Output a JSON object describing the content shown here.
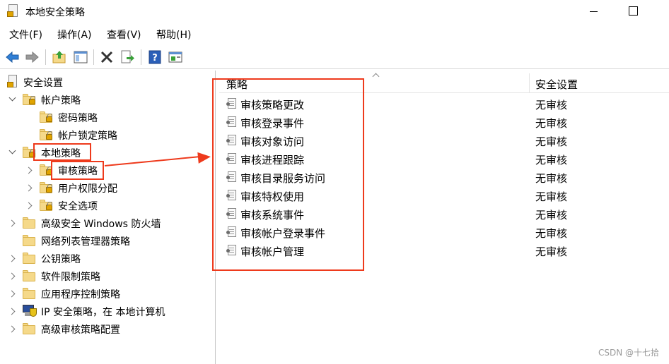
{
  "window": {
    "title": "本地安全策略"
  },
  "menu": [
    {
      "label": "文件(F)"
    },
    {
      "label": "操作(A)"
    },
    {
      "label": "查看(V)"
    },
    {
      "label": "帮助(H)"
    }
  ],
  "toolbar": {
    "buttons": [
      "back-icon",
      "forward-icon",
      "up-folder-icon",
      "show-hide-tree-icon",
      "delete-icon",
      "export-list-icon",
      "help-icon",
      "properties-icon"
    ]
  },
  "tree": {
    "root": {
      "label": "安全设置"
    },
    "account_policies": {
      "label": "帐户策略",
      "expanded": true
    },
    "password_policy": {
      "label": "密码策略"
    },
    "lockout_policy": {
      "label": "帐户锁定策略"
    },
    "local_policies": {
      "label": "本地策略",
      "expanded": true
    },
    "audit_policy": {
      "label": "审核策略",
      "selected": true
    },
    "user_rights": {
      "label": "用户权限分配"
    },
    "security_options": {
      "label": "安全选项"
    },
    "firewall": {
      "label": "高级安全 Windows 防火墙"
    },
    "network_list": {
      "label": "网络列表管理器策略"
    },
    "public_key": {
      "label": "公钥策略"
    },
    "software_restriction": {
      "label": "软件限制策略"
    },
    "app_control": {
      "label": "应用程序控制策略"
    },
    "ipsec": {
      "label": "IP 安全策略，在 本地计算机"
    },
    "advanced_audit": {
      "label": "高级审核策略配置"
    }
  },
  "list": {
    "columns": {
      "policy": "策略",
      "setting": "安全设置"
    },
    "rows": [
      {
        "name": "审核策略更改",
        "value": "无审核"
      },
      {
        "name": "审核登录事件",
        "value": "无审核"
      },
      {
        "name": "审核对象访问",
        "value": "无审核"
      },
      {
        "name": "审核进程跟踪",
        "value": "无审核"
      },
      {
        "name": "审核目录服务访问",
        "value": "无审核"
      },
      {
        "name": "审核特权使用",
        "value": "无审核"
      },
      {
        "name": "审核系统事件",
        "value": "无审核"
      },
      {
        "name": "审核帐户登录事件",
        "value": "无审核"
      },
      {
        "name": "审核帐户管理",
        "value": "无审核"
      }
    ]
  },
  "annotation": {
    "color": "#ee3a1c"
  },
  "watermark": "CSDN @十七拾"
}
